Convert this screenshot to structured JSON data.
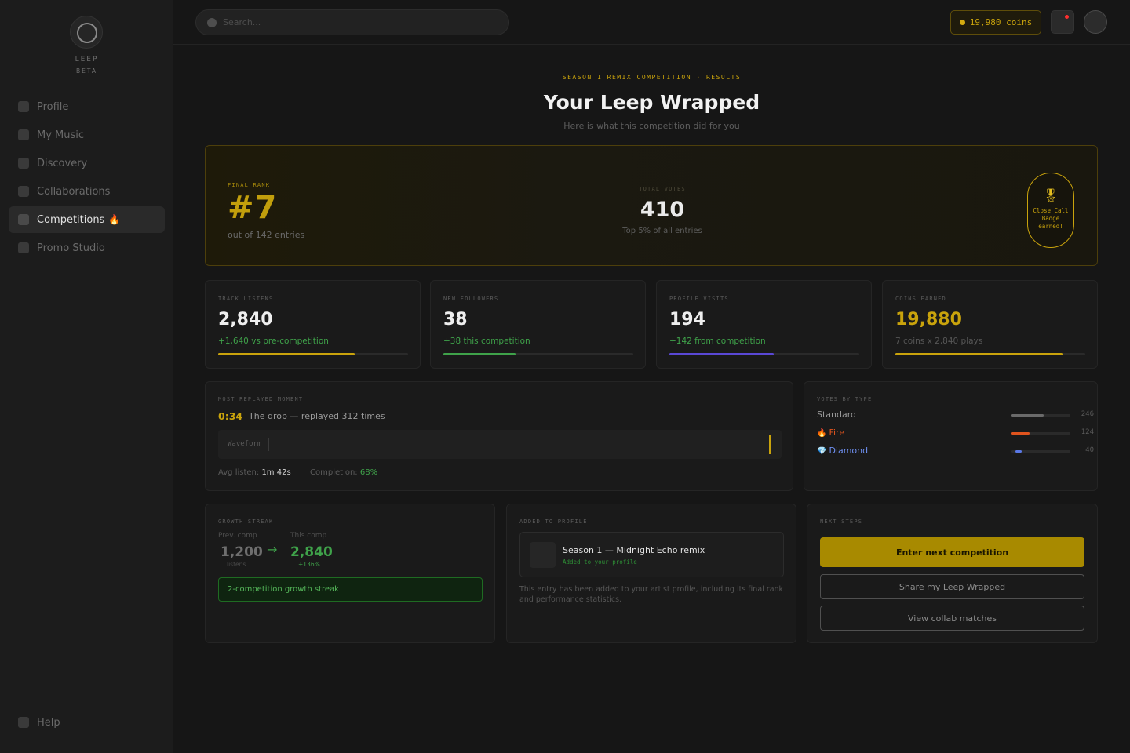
{
  "sidebar": {
    "logo_text": "LEEP",
    "logo_tag": "BETA",
    "items": [
      {
        "label": "Profile"
      },
      {
        "label": "My Music"
      },
      {
        "label": "Discovery"
      },
      {
        "label": "Collaborations"
      },
      {
        "label": "Competitions",
        "badge": "🔥"
      },
      {
        "label": "Promo Studio"
      }
    ],
    "help_label": "Help"
  },
  "topbar": {
    "search_placeholder": "Search...",
    "coins_label": "19,980 coins"
  },
  "header": {
    "eyebrow": "SEASON 1 REMIX COMPETITION · RESULTS",
    "title": "Your Leep Wrapped",
    "subtitle": "Here is what this competition did for you"
  },
  "hero": {
    "rank_label": "FINAL RANK",
    "rank": "#7",
    "rank_sub": "out of 142 entries",
    "votes_label": "TOTAL VOTES",
    "votes": "410",
    "votes_sub": "Top 5% of all entries",
    "badge_icon": "🎖",
    "badge_text": "Close Call Badge earned!"
  },
  "stats": [
    {
      "label": "TRACK LISTENS",
      "value": "2,840",
      "delta": "+1,640 vs pre-competition",
      "progress": 0.72,
      "color": "#c9a30c",
      "delta_color": "#3fa24a"
    },
    {
      "label": "NEW FOLLOWERS",
      "value": "38",
      "delta": "+38 this competition",
      "progress": 0.38,
      "color": "#3fa24a",
      "delta_color": "#3fa24a"
    },
    {
      "label": "PROFILE VISITS",
      "value": "194",
      "delta": "+142 from competition",
      "progress": 0.55,
      "color": "#5a48d6",
      "delta_color": "#3fa24a"
    },
    {
      "label": "COINS EARNED",
      "value": "19,880",
      "delta": "7 coins x 2,840 plays",
      "progress": 0.88,
      "color": "#c9a30c",
      "delta_color": "#565656",
      "value_color": "#c9a30c"
    }
  ],
  "moment": {
    "label": "MOST REPLAYED MOMENT",
    "time": "0:34",
    "desc": "The drop — replayed 312 times",
    "waveform_label": "Waveform",
    "avg_label": "Avg listen:",
    "avg_value": "1m 42s",
    "completion_label": "Completion:",
    "completion_value": "68%"
  },
  "votes_by_type": {
    "label": "VOTES BY TYPE",
    "rows": [
      {
        "name": "Standard",
        "icon": "",
        "count": "246",
        "fraction": 0.55,
        "color": "#6a6a6a",
        "name_color": "#9a9a9a"
      },
      {
        "name": "Fire",
        "icon": "🔥",
        "count": "124",
        "fraction": 0.32,
        "color": "#e0541e",
        "name_color": "#e0541e"
      },
      {
        "name": "Diamond",
        "icon": "💎",
        "count": "40",
        "fraction": 0.1,
        "color": "#5a78e6",
        "name_color": "#6e8ff0"
      }
    ]
  },
  "streak": {
    "label": "GROWTH STREAK",
    "prev_label": "Prev. comp",
    "prev_value": "1,200",
    "prev_unit": "listens",
    "this_label": "This comp",
    "this_value": "2,840",
    "this_change": "+136%",
    "box_text": "2-competition growth streak"
  },
  "added": {
    "label": "ADDED TO PROFILE",
    "title": "Season 1 — Midnight Echo remix",
    "tag": "Added to your profile",
    "note": "This entry has been added to your artist profile, including its final rank and performance statistics."
  },
  "next_steps": {
    "label": "NEXT STEPS",
    "primary": "Enter next competition",
    "share": "Share my Leep Wrapped",
    "collab": "View collab matches"
  }
}
